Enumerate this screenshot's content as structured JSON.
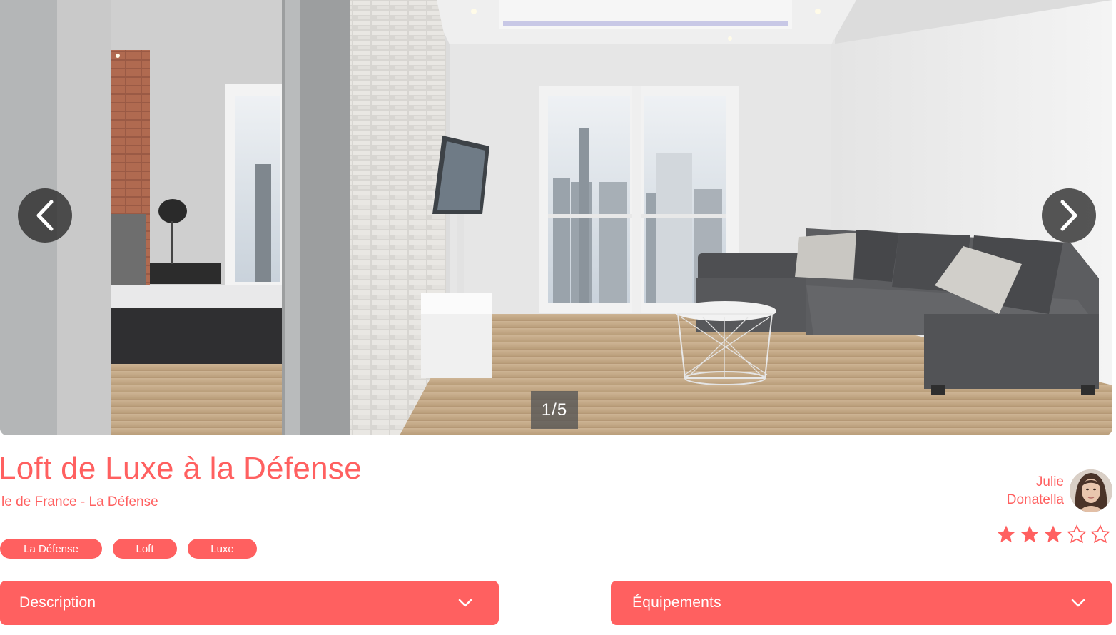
{
  "carousel": {
    "counter": "1/5",
    "image_description_icon": "apartment-photo",
    "prev_icon": "chevron-left-icon",
    "next_icon": "chevron-right-icon"
  },
  "listing": {
    "title": "Loft de Luxe à la Défense",
    "location": "le de France - La Défense",
    "tags": [
      "La Défense",
      "Loft",
      "Luxe"
    ],
    "rating": 3,
    "rating_max": 5
  },
  "host": {
    "first_name": "Julie",
    "last_name": "Donatella"
  },
  "collapses": {
    "description": "Description",
    "equipments": "Équipements"
  },
  "colors": {
    "accent": "#FF6060",
    "star_empty": "#FF6060",
    "nav_bg": "#282828"
  }
}
